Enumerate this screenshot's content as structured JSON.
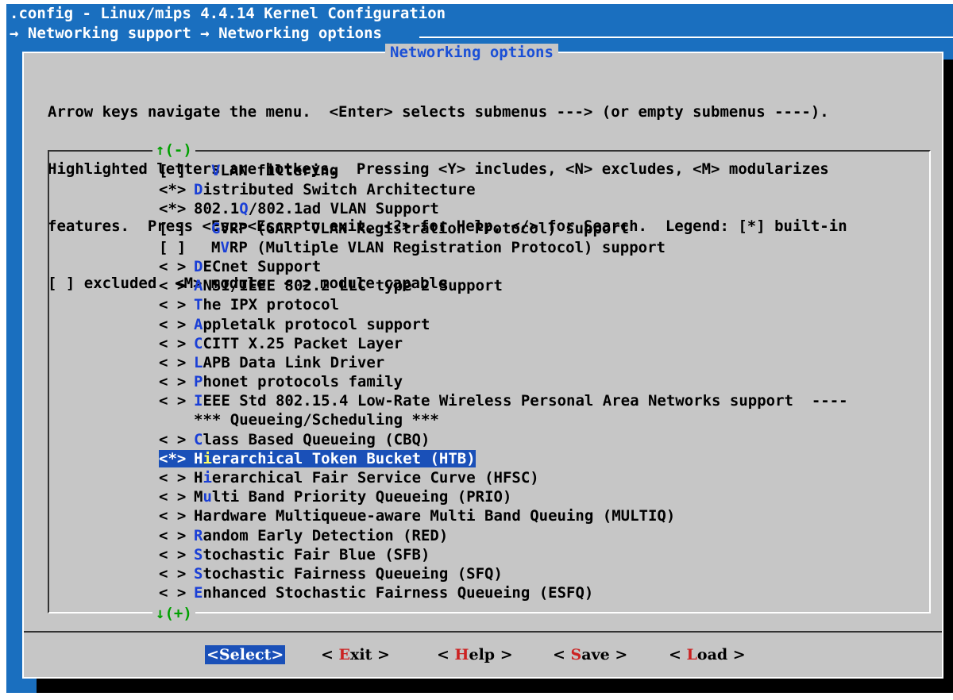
{
  "window": {
    "title": ".config - Linux/mips 4.4.14 Kernel Configuration",
    "breadcrumb": "→ Networking support → Networking options"
  },
  "dialog": {
    "title": "Networking options",
    "help_lines": [
      "Arrow keys navigate the menu.  <Enter> selects submenus ---> (or empty submenus ----).",
      "Highlighted letters are hotkeys.  Pressing <Y> includes, <N> excludes, <M> modularizes",
      "features.  Press <Esc><Esc> to exit, <?> for Help, </> for Search.  Legend: [*] built-in",
      "[ ] excluded  <M> module  < > module capable"
    ],
    "scroll_up": "↑(-)",
    "scroll_down": "↓(+)"
  },
  "menu": {
    "items": [
      {
        "marker": "[ ]",
        "indent": true,
        "hotkey": "V",
        "rest": "LAN filtering"
      },
      {
        "marker": "<*>",
        "indent": false,
        "hotkey": "D",
        "rest": "istributed Switch Architecture"
      },
      {
        "marker": "<*>",
        "indent": false,
        "prefix": "802.1",
        "hotkey": "Q",
        "rest": "/802.1ad VLAN Support"
      },
      {
        "marker": "[ ]",
        "indent": true,
        "hotkey": "G",
        "rest": "VRP (GARP VLAN Registration Protocol) support"
      },
      {
        "marker": "[ ]",
        "indent": true,
        "prefix": "M",
        "hotkey": "V",
        "rest": "RP (Multiple VLAN Registration Protocol) support"
      },
      {
        "marker": "< >",
        "indent": false,
        "hotkey": "D",
        "rest": "ECnet Support"
      },
      {
        "marker": "< >",
        "indent": false,
        "hotkey": "A",
        "rest": "NSI/IEEE 802.2 LLC type 2 Support"
      },
      {
        "marker": "< >",
        "indent": false,
        "hotkey": "T",
        "rest": "he IPX protocol"
      },
      {
        "marker": "< >",
        "indent": false,
        "hotkey": "A",
        "rest": "ppletalk protocol support"
      },
      {
        "marker": "< >",
        "indent": false,
        "hotkey": "C",
        "rest": "CITT X.25 Packet Layer"
      },
      {
        "marker": "< >",
        "indent": false,
        "hotkey": "L",
        "rest": "APB Data Link Driver"
      },
      {
        "marker": "< >",
        "indent": false,
        "hotkey": "P",
        "rest": "honet protocols family"
      },
      {
        "marker": "< >",
        "indent": false,
        "hotkey": "I",
        "rest": "EEE Std 802.15.4 Low-Rate Wireless Personal Area Networks support  ----"
      },
      {
        "marker": "",
        "indent": false,
        "hotkey": "",
        "rest": "*** Queueing/Scheduling ***"
      },
      {
        "marker": "< >",
        "indent": false,
        "hotkey": "C",
        "rest": "lass Based Queueing (CBQ)"
      },
      {
        "marker": "<*>",
        "indent": false,
        "prefix": "H",
        "hotkey": "i",
        "rest": "erarchical Token Bucket (HTB)",
        "selected": true
      },
      {
        "marker": "< >",
        "indent": false,
        "prefix": "H",
        "hotkey": "i",
        "rest": "erarchical Fair Service Curve (HFSC)"
      },
      {
        "marker": "< >",
        "indent": false,
        "prefix": "M",
        "hotkey": "u",
        "rest": "lti Band Priority Queueing (PRIO)"
      },
      {
        "marker": "< >",
        "indent": false,
        "prefix": "Hardware Multiqueue-aware Multi Band Queuing (MULTIQ)",
        "hotkey": "",
        "rest": ""
      },
      {
        "marker": "< >",
        "indent": false,
        "hotkey": "R",
        "rest": "andom Early Detection (RED)"
      },
      {
        "marker": "< >",
        "indent": false,
        "hotkey": "S",
        "rest": "tochastic Fair Blue (SFB)"
      },
      {
        "marker": "< >",
        "indent": false,
        "hotkey": "S",
        "rest": "tochastic Fairness Queueing (SFQ)"
      },
      {
        "marker": "< >",
        "indent": false,
        "hotkey": "E",
        "rest": "nhanced Stochastic Fairness Queueing (ESFQ)"
      }
    ]
  },
  "buttons": {
    "select": {
      "open": "<",
      "label": "Select",
      "close": ">"
    },
    "exit": {
      "open": "< ",
      "hotkey": "E",
      "rest": "xit",
      "close": " >"
    },
    "help": {
      "open": "< ",
      "hotkey": "H",
      "rest": "elp",
      "close": " >"
    },
    "save": {
      "open": "< ",
      "hotkey": "S",
      "rest": "ave",
      "close": " >"
    },
    "load": {
      "open": "< ",
      "hotkey": "L",
      "rest": "oad",
      "close": " >"
    }
  },
  "colors": {
    "background": "#1a6fbf",
    "dialog": "#c6c6c6",
    "selection": "#1a50b8",
    "hotkey": "#1a3fd6",
    "button_hotkey": "#cc2222",
    "scroll_arrows": "#00a000"
  }
}
